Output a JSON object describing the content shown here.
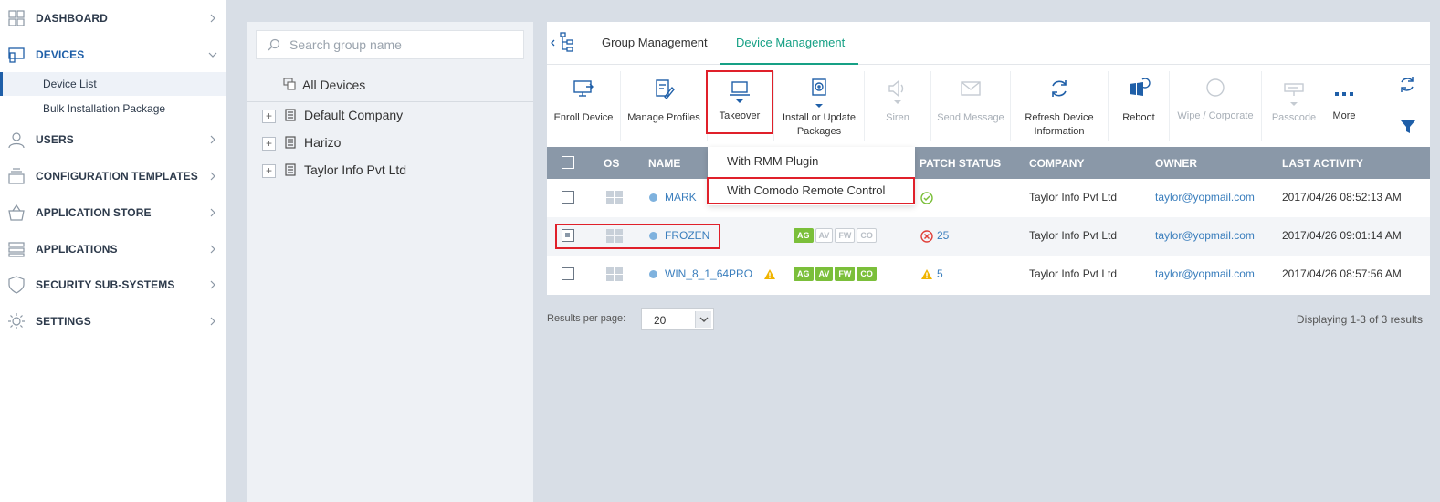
{
  "sidebar": {
    "items": [
      {
        "label": "DASHBOARD"
      },
      {
        "label": "DEVICES"
      },
      {
        "label": "USERS"
      },
      {
        "label": "CONFIGURATION TEMPLATES"
      },
      {
        "label": "APPLICATION STORE"
      },
      {
        "label": "APPLICATIONS"
      },
      {
        "label": "SECURITY SUB-SYSTEMS"
      },
      {
        "label": "SETTINGS"
      }
    ],
    "subitems": [
      {
        "label": "Device List"
      },
      {
        "label": "Bulk Installation Package"
      }
    ]
  },
  "groups": {
    "search_placeholder": "Search group name",
    "all_devices": "All Devices",
    "items": [
      {
        "label": "Default Company"
      },
      {
        "label": "Harizo"
      },
      {
        "label": "Taylor Info Pvt Ltd"
      }
    ]
  },
  "tabs": [
    {
      "label": "Group Management"
    },
    {
      "label": "Device Management"
    }
  ],
  "toolbar": {
    "enroll": "Enroll Device",
    "profiles": "Manage Profiles",
    "takeover": "Takeover",
    "install_1": "Install or Update",
    "install_2": "Packages",
    "siren": "Siren",
    "message": "Send Message",
    "refresh_1": "Refresh Device",
    "refresh_2": "Information",
    "reboot": "Reboot",
    "wipe": "Wipe / Corporate",
    "passcode": "Passcode",
    "more": "More"
  },
  "takeover_menu": {
    "items": [
      {
        "label": "With RMM Plugin"
      },
      {
        "label": "With Comodo Remote Control"
      }
    ]
  },
  "table": {
    "headers": {
      "os": "OS",
      "name": "NAME",
      "patch": "PATCH STATUS",
      "company": "COMPANY",
      "owner": "OWNER",
      "activity": "LAST ACTIVITY"
    },
    "rows": [
      {
        "name": "MARK",
        "patch": "",
        "company": "Taylor Info Pvt Ltd",
        "owner": "taylor@yopmail.com",
        "activity": "2017/04/26 08:52:13 AM"
      },
      {
        "name": "FROZEN",
        "patch": "25",
        "company": "Taylor Info Pvt Ltd",
        "owner": "taylor@yopmail.com",
        "activity": "2017/04/26 09:01:14 AM"
      },
      {
        "name": "WIN_8_1_64PRO",
        "patch": "5",
        "company": "Taylor Info Pvt Ltd",
        "owner": "taylor@yopmail.com",
        "activity": "2017/04/26 08:57:56 AM"
      }
    ],
    "badges": [
      "AG",
      "AV",
      "FW",
      "CO"
    ]
  },
  "footer": {
    "results_label": "Results per page:",
    "per_page": "20",
    "displaying": "Displaying 1-3 of 3 results"
  },
  "colors": {
    "accent": "#16a085",
    "link": "#3a7ebd",
    "highlight": "#e0202a",
    "table_header": "#8a98a8"
  }
}
